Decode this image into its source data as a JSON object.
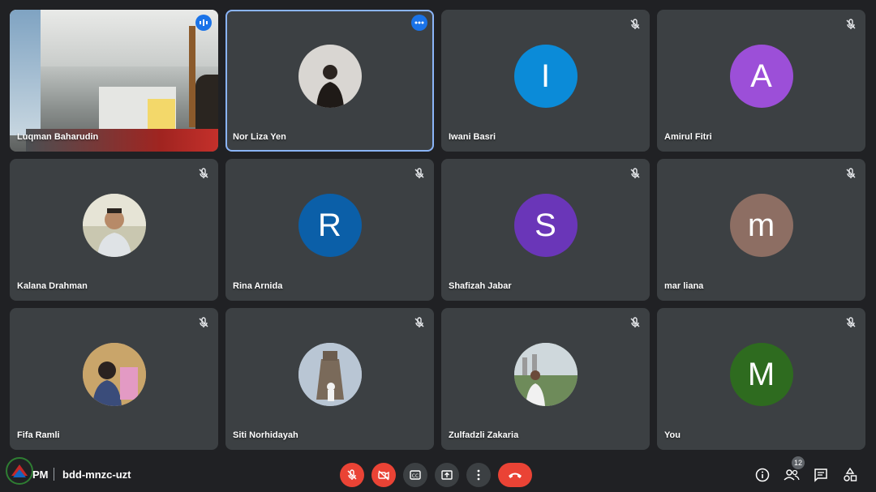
{
  "participants": [
    {
      "name": "Luqman Baharudin",
      "type": "video",
      "muted": false,
      "speaking": true
    },
    {
      "name": "Nor Liza Yen",
      "type": "photo",
      "muted": false,
      "active": true,
      "photo_color": "#d9d6d2"
    },
    {
      "name": "Iwani Basri",
      "type": "letter",
      "letter": "I",
      "color": "#0b8bd8",
      "muted": true
    },
    {
      "name": "Amirul Fitri",
      "type": "letter",
      "letter": "A",
      "color": "#9c4fd8",
      "muted": true
    },
    {
      "name": "Kalana Drahman",
      "type": "photo",
      "muted": true,
      "photo_color": "#c9c7b0"
    },
    {
      "name": "Rina Arnida",
      "type": "letter",
      "letter": "R",
      "color": "#0b5fa8",
      "muted": true
    },
    {
      "name": "Shafizah Jabar",
      "type": "letter",
      "letter": "S",
      "color": "#6a36b8",
      "muted": true
    },
    {
      "name": "mar liana",
      "type": "letter",
      "letter": "m",
      "color": "#8d6e63",
      "muted": true
    },
    {
      "name": "Fifa Ramli",
      "type": "photo",
      "muted": true,
      "photo_color": "#b88f7b"
    },
    {
      "name": "Siti Norhidayah",
      "type": "photo",
      "muted": true,
      "photo_color": "#a6b3c4"
    },
    {
      "name": "Zulfadzli Zakaria",
      "type": "photo",
      "muted": true,
      "photo_color": "#9db0a5"
    },
    {
      "name": "You",
      "type": "letter",
      "letter": "M",
      "color": "#2e6b1f",
      "muted": true
    }
  ],
  "bottom_bar": {
    "time": "PM",
    "meeting_code": "bdd-mnzc-uzt",
    "participant_count": "12",
    "controls": [
      "mic-off-icon",
      "camera-off-icon",
      "captions-icon",
      "present-icon",
      "more-icon",
      "hang-up-icon"
    ],
    "right_icons": [
      "info-icon",
      "people-icon",
      "chat-icon",
      "activities-icon"
    ]
  },
  "colors": {
    "background": "#202124",
    "tile": "#3c4043",
    "danger": "#ea4335",
    "accent": "#8ab4f8",
    "badge": "#1a73e8"
  }
}
